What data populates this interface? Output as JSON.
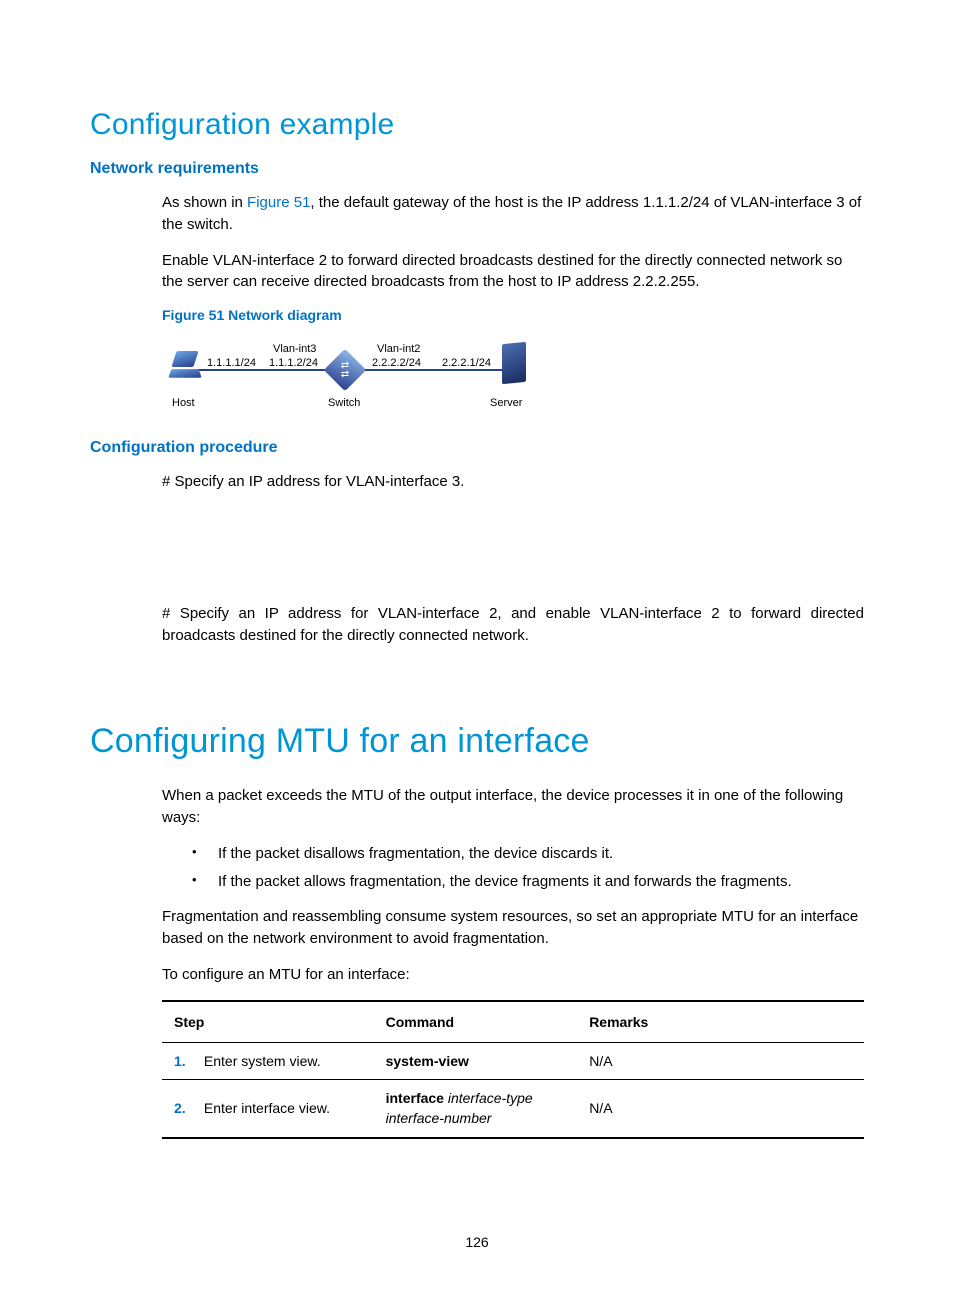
{
  "page_number": "126",
  "section1": {
    "title": "Configuration example",
    "netreq": {
      "heading": "Network requirements",
      "p1_a": "As shown in ",
      "p1_link": "Figure 51",
      "p1_b": ", the default gateway of the host is the IP address 1.1.1.2/24 of VLAN-interface 3 of the switch.",
      "p2": "Enable VLAN-interface 2 to forward directed broadcasts destined for the directly connected network so the server can receive directed broadcasts from the host to IP address 2.2.2.255.",
      "fig_title": "Figure 51 Network diagram",
      "diagram": {
        "host_ip": "1.1.1.1/24",
        "vlan3": "Vlan-int3",
        "vlan3_ip": "1.1.1.2/24",
        "vlan2": "Vlan-int2",
        "vlan2_ip": "2.2.2.2/24",
        "server_ip": "2.2.2.1/24",
        "host_lbl": "Host",
        "switch_lbl": "Switch",
        "server_lbl": "Server"
      }
    },
    "proc": {
      "heading": "Configuration procedure",
      "p1": "# Specify an IP address for VLAN-interface 3.",
      "p2": "# Specify an IP address for VLAN-interface 2, and enable VLAN-interface 2 to forward directed broadcasts destined for the directly connected network."
    }
  },
  "section2": {
    "title": "Configuring MTU for an interface",
    "p1": "When a packet exceeds the MTU of the output interface, the device processes it in one of the following ways:",
    "bullets": [
      "If the packet disallows fragmentation, the device discards it.",
      "If the packet allows fragmentation, the device fragments it and forwards the fragments."
    ],
    "p2": "Fragmentation and reassembling consume system resources, so set an appropriate MTU for an interface based on the network environment to avoid fragmentation.",
    "p3": "To configure an MTU for an interface:",
    "table": {
      "headers": {
        "step": "Step",
        "command": "Command",
        "remarks": "Remarks"
      },
      "rows": [
        {
          "num": "1.",
          "step": "Enter system view.",
          "cmd_bold": "system-view",
          "cmd_italic": "",
          "remarks": "N/A"
        },
        {
          "num": "2.",
          "step": "Enter interface view.",
          "cmd_bold": "interface",
          "cmd_italic": " interface-type interface-number",
          "remarks": "N/A"
        }
      ]
    }
  }
}
